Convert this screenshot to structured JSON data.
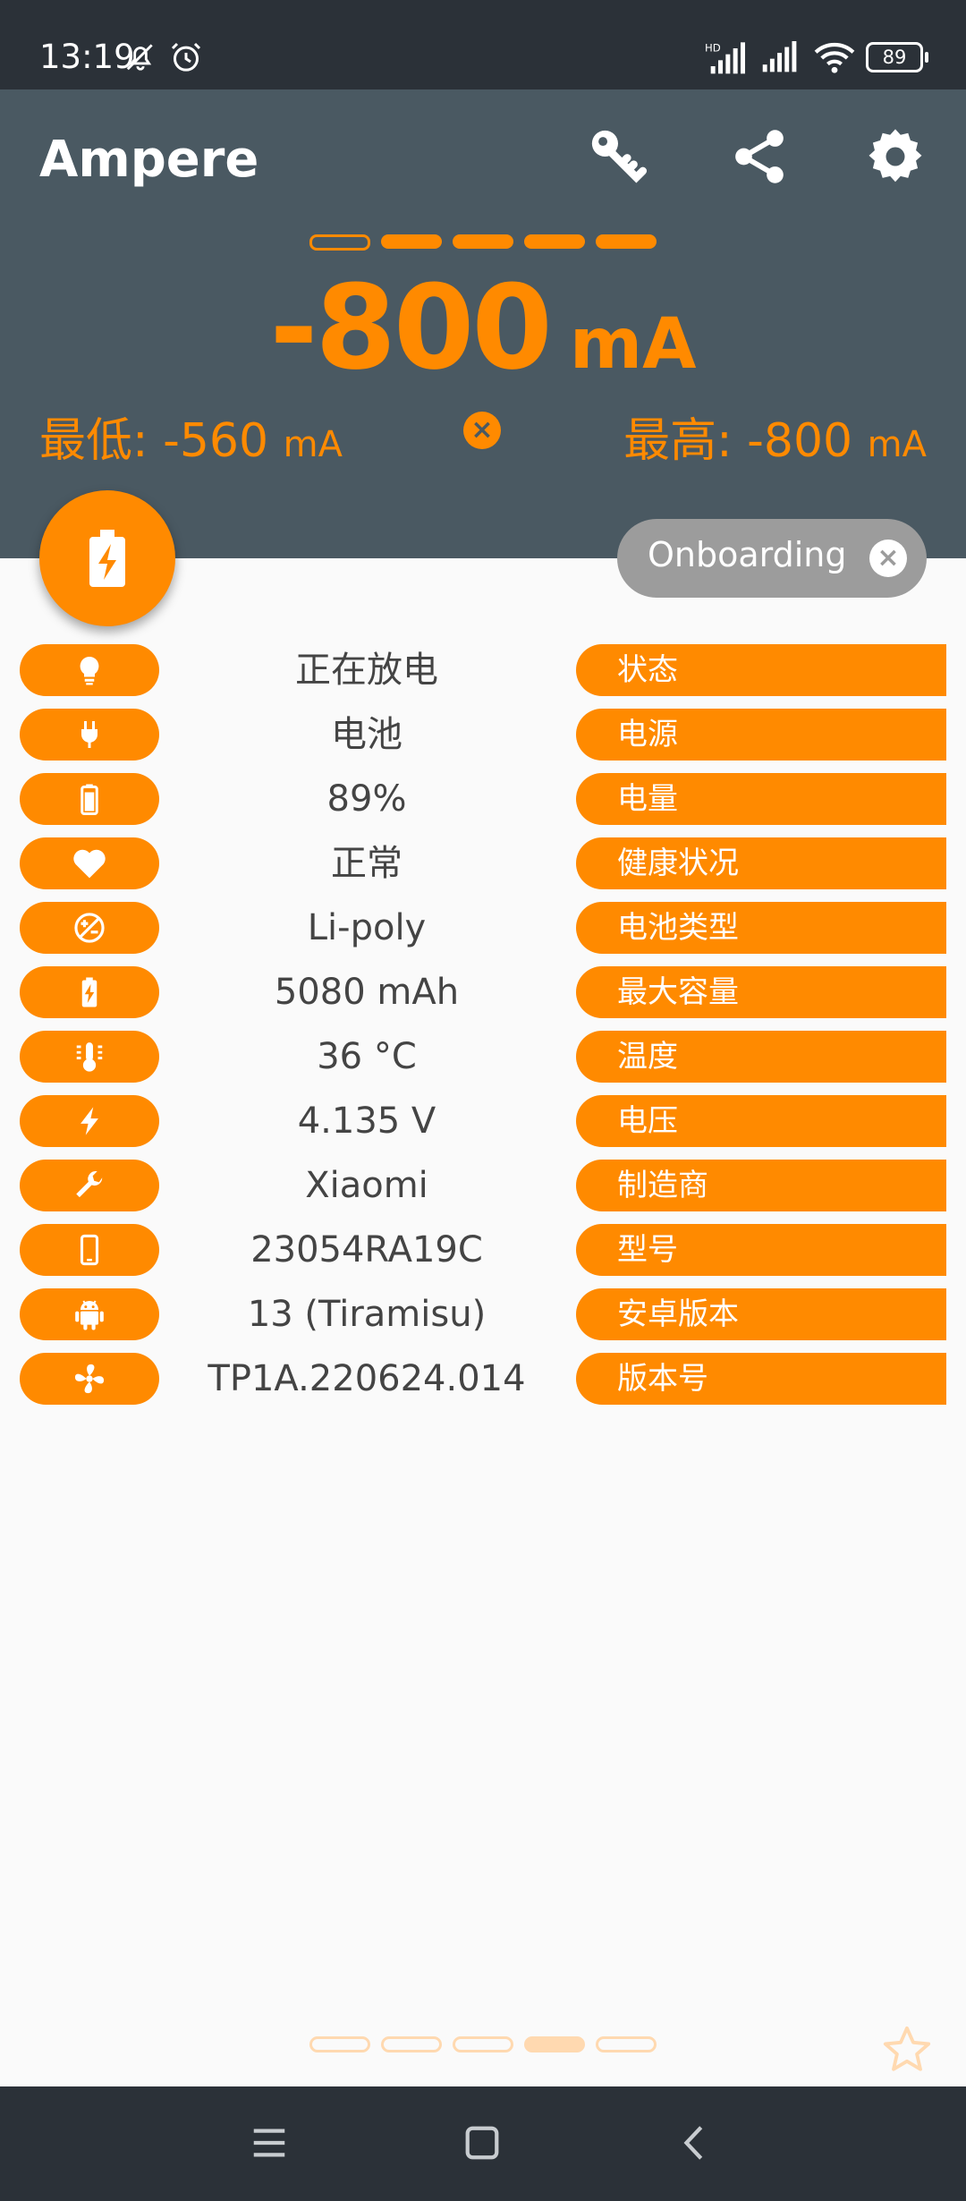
{
  "status_bar": {
    "time": "13:19",
    "battery": "89"
  },
  "app": {
    "title": "Ampere"
  },
  "reading": {
    "value": "-800",
    "unit": "mA"
  },
  "min": {
    "label": "最低:",
    "value": "-560",
    "unit": "mA"
  },
  "max": {
    "label": "最高:",
    "value": "-800",
    "unit": "mA"
  },
  "chip": {
    "label": "Onboarding"
  },
  "rows": [
    {
      "icon": "bulb-icon",
      "value": "正在放电",
      "label": "状态"
    },
    {
      "icon": "plug-icon",
      "value": "电池",
      "label": "电源"
    },
    {
      "icon": "battery-icon",
      "value": "89%",
      "label": "电量"
    },
    {
      "icon": "heart-icon",
      "value": "正常",
      "label": "健康状况"
    },
    {
      "icon": "battery-type-icon",
      "value": "Li-poly",
      "label": "电池类型"
    },
    {
      "icon": "battery-charging-icon",
      "value": "5080 mAh",
      "label": "最大容量"
    },
    {
      "icon": "thermometer-icon",
      "value": "36 °C",
      "label": "温度"
    },
    {
      "icon": "lightning-icon",
      "value": "4.135 V",
      "label": "电压"
    },
    {
      "icon": "wrench-icon",
      "value": "Xiaomi",
      "label": "制造商"
    },
    {
      "icon": "phone-icon",
      "value": "23054RA19C",
      "label": "型号"
    },
    {
      "icon": "android-icon",
      "value": "13 (Tiramisu)",
      "label": "安卓版本"
    },
    {
      "icon": "fan-icon",
      "value": "TP1A.220624.014",
      "label": "版本号"
    }
  ],
  "colors": {
    "accent": "#ff8a00",
    "header": "#4a5962",
    "bars": "#2b3138"
  }
}
